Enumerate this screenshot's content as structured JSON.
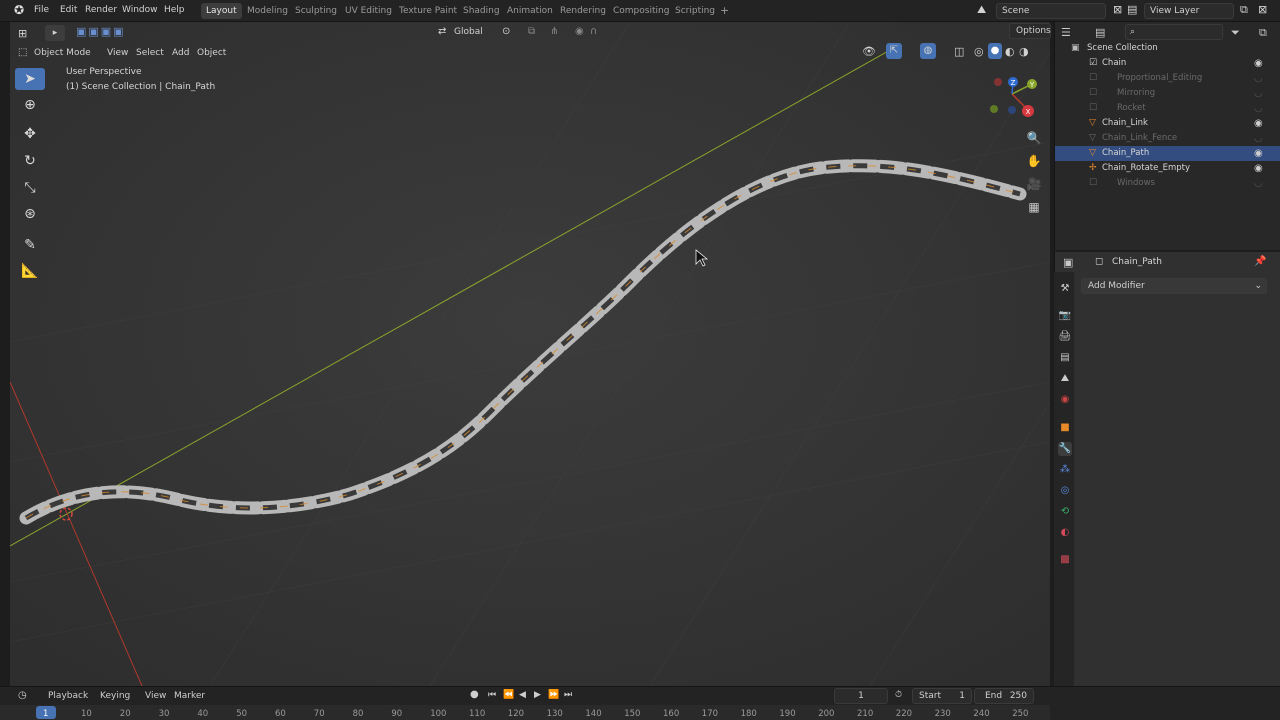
{
  "menu": {
    "file": "File",
    "edit": "Edit",
    "render": "Render",
    "window": "Window",
    "help": "Help"
  },
  "workspaces": [
    "Layout",
    "Modeling",
    "Sculpting",
    "UV Editing",
    "Texture Paint",
    "Shading",
    "Animation",
    "Rendering",
    "Compositing",
    "Scripting"
  ],
  "add_workspace": "+",
  "scene": {
    "name": "Scene",
    "view_layer": "View Layer"
  },
  "viewport_header": {
    "mode": "Object Mode",
    "view": "View",
    "select": "Select",
    "add": "Add",
    "object": "Object",
    "orientation": "Global",
    "options": "Options"
  },
  "viewport": {
    "perspective": "User Perspective",
    "collection": "(1) Scene Collection | Chain_Path"
  },
  "gizmo": {
    "x": "X",
    "y": "Y",
    "z": "Z"
  },
  "outliner": {
    "root": "Scene Collection",
    "items": [
      {
        "name": "Chain",
        "dim": false,
        "eye": true
      },
      {
        "name": "Proportional_Editing",
        "dim": true,
        "eye": false
      },
      {
        "name": "Mirroring",
        "dim": true,
        "eye": false
      },
      {
        "name": "Rocket",
        "dim": true,
        "eye": false
      },
      {
        "name": "Chain_Link",
        "dim": false,
        "eye": true
      },
      {
        "name": "Chain_Link_Fence",
        "dim": true,
        "eye": false
      },
      {
        "name": "Chain_Path",
        "dim": false,
        "eye": true,
        "selected": true
      },
      {
        "name": "Chain_Rotate_Empty",
        "dim": false,
        "eye": true
      },
      {
        "name": "Windows",
        "dim": true,
        "eye": false
      }
    ]
  },
  "properties": {
    "object_name": "Chain_Path",
    "add_modifier": "Add Modifier"
  },
  "timeline": {
    "playback": "Playback",
    "keying": "Keying",
    "view": "View",
    "marker": "Marker",
    "current_frame": "1",
    "start_label": "Start",
    "start": "1",
    "end_label": "End",
    "end": "250",
    "ticks": [
      "1",
      "10",
      "20",
      "30",
      "40",
      "50",
      "60",
      "70",
      "80",
      "90",
      "100",
      "110",
      "120",
      "130",
      "140",
      "150",
      "160",
      "170",
      "180",
      "190",
      "200",
      "210",
      "220",
      "230",
      "240",
      "250"
    ]
  },
  "colors": {
    "accent": "#4772b3",
    "selected_row": "#334d80",
    "chain_metal": "#b8b8b8",
    "x_axis": "#c0392b",
    "y_axis": "#8aa62b"
  }
}
